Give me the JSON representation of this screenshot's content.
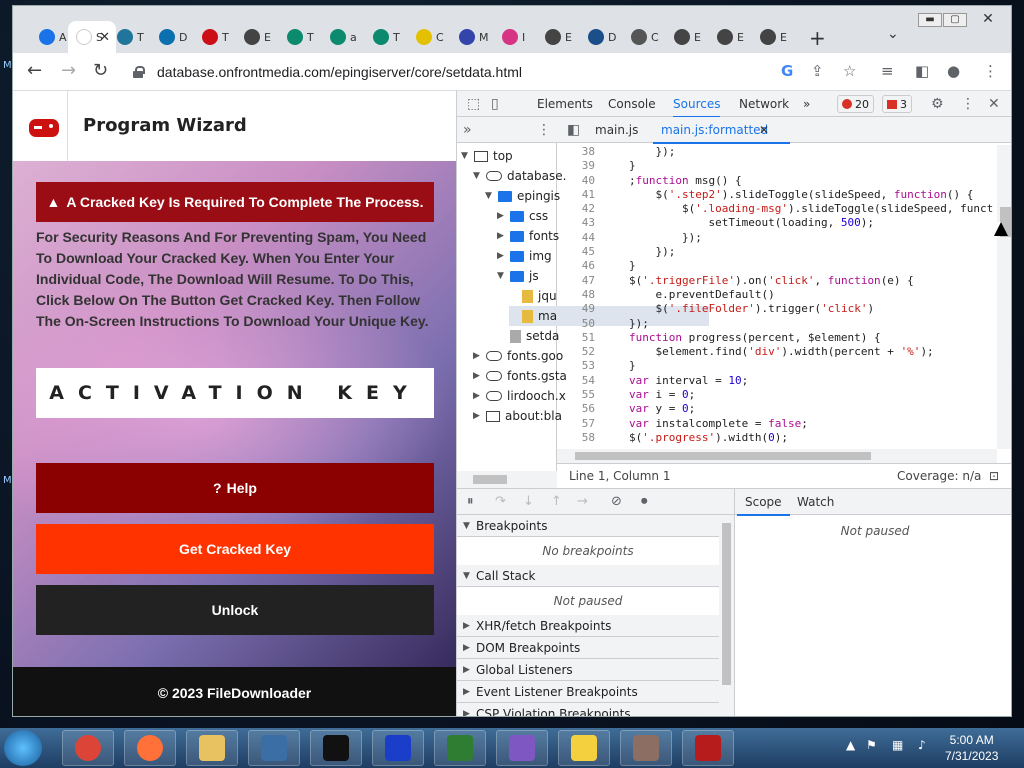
{
  "browser": {
    "tabs": [
      {
        "label": "A",
        "icon": "loading-icon",
        "color": "#1a73e8"
      },
      {
        "label": "S",
        "icon": "page-icon",
        "color": "#ffffff",
        "active": true
      },
      {
        "label": "T",
        "icon": "wordpress-icon",
        "color": "#21759b"
      },
      {
        "label": "D",
        "icon": "cloud-icon",
        "color": "#0b6fb0"
      },
      {
        "label": "T",
        "icon": "opera-icon",
        "color": "#cc0f16"
      },
      {
        "label": "E",
        "icon": "globe-icon",
        "color": "#444444"
      },
      {
        "label": "T",
        "icon": "play-icon",
        "color": "#0b8a6e"
      },
      {
        "label": "a",
        "icon": "play-icon",
        "color": "#0b8a6e"
      },
      {
        "label": "T",
        "icon": "play-icon",
        "color": "#0b8a6e"
      },
      {
        "label": "C",
        "icon": "check-icon",
        "color": "#e3c000"
      },
      {
        "label": "M",
        "icon": "world-icon",
        "color": "#3344aa"
      },
      {
        "label": "I",
        "icon": "ai-icon",
        "color": "#d63384"
      },
      {
        "label": "E",
        "icon": "globe-icon",
        "color": "#444444"
      },
      {
        "label": "D",
        "icon": "s-icon",
        "color": "#1b4f8a"
      },
      {
        "label": "C",
        "icon": "chrome-icon",
        "color": "#555555"
      },
      {
        "label": "E",
        "icon": "globe-icon",
        "color": "#444444"
      },
      {
        "label": "E",
        "icon": "globe-icon",
        "color": "#444444"
      },
      {
        "label": "E",
        "icon": "globe-icon",
        "color": "#444444"
      }
    ],
    "url": "database.onfrontmedia.com/epingiserver/core/setdata.html"
  },
  "page": {
    "title": "Program Wizard",
    "alert": "A Cracked Key Is Required To Complete The Process.",
    "body": "For Security Reasons And For Preventing Spam, You Need To Download Your Cracked Key. When You Enter Your Individual Code, The Download Will Resume. To Do This, Click Below On The Button Get Cracked Key. Then Follow The On-Screen Instructions To Download Your Unique Key.",
    "activation_key": "ACTIVATION KEY",
    "help_button": "Help",
    "get_key_button": "Get Cracked Key",
    "unlock_button": "Unlock",
    "footer": "© 2023 FileDownloader"
  },
  "devtools": {
    "tabs": [
      "Elements",
      "Console",
      "Sources",
      "Network"
    ],
    "active_tab": "Sources",
    "errors": "20",
    "warnings": "3",
    "file_tree": [
      {
        "label": "top",
        "icon": "frame-icon",
        "depth": 0,
        "expanded": true
      },
      {
        "label": "database.",
        "icon": "cloud-icon",
        "depth": 1,
        "expanded": true
      },
      {
        "label": "epingis",
        "icon": "folder-icon",
        "depth": 2,
        "expanded": true
      },
      {
        "label": "css",
        "icon": "folder-icon",
        "depth": 3,
        "expanded": false
      },
      {
        "label": "fonts",
        "icon": "folder-icon",
        "depth": 3,
        "expanded": false
      },
      {
        "label": "img",
        "icon": "folder-icon",
        "depth": 3,
        "expanded": false
      },
      {
        "label": "js",
        "icon": "folder-icon",
        "depth": 3,
        "expanded": true
      },
      {
        "label": "jqu",
        "icon": "file-icon",
        "depth": 4
      },
      {
        "label": "ma",
        "icon": "file-icon",
        "depth": 4,
        "selected": true
      },
      {
        "label": "setda",
        "icon": "file-icon",
        "depth": 3
      },
      {
        "label": "fonts.goo",
        "icon": "cloud-icon",
        "depth": 1,
        "expanded": false
      },
      {
        "label": "fonts.gsta",
        "icon": "cloud-icon",
        "depth": 1,
        "expanded": false
      },
      {
        "label": "lirdooch.x",
        "icon": "cloud-icon",
        "depth": 1,
        "expanded": false
      },
      {
        "label": "about:bla",
        "icon": "frame-icon",
        "depth": 1,
        "expanded": false
      }
    ],
    "editor_tabs": [
      "main.js",
      "main.js:formatted"
    ],
    "code": [
      {
        "n": "38",
        "t": "        });"
      },
      {
        "n": "39",
        "t": "    }"
      },
      {
        "n": "40",
        "t": "    ;function msg() {"
      },
      {
        "n": "41",
        "t": "        $('.step2').slideToggle(slideSpeed, function() {"
      },
      {
        "n": "42",
        "t": "            $('.loading-msg').slideToggle(slideSpeed, funct"
      },
      {
        "n": "43",
        "t": "                setTimeout(loading, 500);"
      },
      {
        "n": "44",
        "t": "            });"
      },
      {
        "n": "45",
        "t": "        });"
      },
      {
        "n": "46",
        "t": "    }"
      },
      {
        "n": "47",
        "t": "    $('.triggerFile').on('click', function(e) {"
      },
      {
        "n": "48",
        "t": "        e.preventDefault()"
      },
      {
        "n": "49",
        "t": "        $('.fileFolder').trigger('click')"
      },
      {
        "n": "50",
        "t": "    });"
      },
      {
        "n": "51",
        "t": "    function progress(percent, $element) {"
      },
      {
        "n": "52",
        "t": "        $element.find('div').width(percent + '%');"
      },
      {
        "n": "53",
        "t": "    }"
      },
      {
        "n": "54",
        "t": "    var interval = 10;"
      },
      {
        "n": "55",
        "t": "    var i = 0;"
      },
      {
        "n": "56",
        "t": "    var y = 0;"
      },
      {
        "n": "57",
        "t": "    var instalcomplete = false;"
      },
      {
        "n": "58",
        "t": "    $('.progress').width(0);"
      }
    ],
    "status_position": "Line 1, Column 1",
    "coverage": "Coverage: n/a",
    "debugger": {
      "sections": [
        {
          "label": "Breakpoints",
          "expanded": true,
          "empty": "No breakpoints"
        },
        {
          "label": "Call Stack",
          "expanded": true,
          "empty": "Not paused"
        },
        {
          "label": "XHR/fetch Breakpoints",
          "expanded": false
        },
        {
          "label": "DOM Breakpoints",
          "expanded": false
        },
        {
          "label": "Global Listeners",
          "expanded": false
        },
        {
          "label": "Event Listener Breakpoints",
          "expanded": false
        },
        {
          "label": "CSP Violation Breakpoints",
          "expanded": false
        }
      ],
      "scope_tabs": [
        "Scope",
        "Watch"
      ],
      "scope_status": "Not paused"
    }
  },
  "taskbar": {
    "apps": [
      {
        "icon": "chrome-icon",
        "color": "#db4437"
      },
      {
        "icon": "firefox-icon",
        "color": "#ff7139"
      },
      {
        "icon": "explorer-icon",
        "color": "#e8c160"
      },
      {
        "icon": "tool-icon",
        "color": "#3a6ea5"
      },
      {
        "icon": "terminal-icon",
        "color": "#111111"
      },
      {
        "icon": "malwarebytes-icon",
        "color": "#1a3ec9"
      },
      {
        "icon": "shield-icon",
        "color": "#2e7d32"
      },
      {
        "icon": "installer-icon",
        "color": "#7e57c2"
      },
      {
        "icon": "puzzle-icon",
        "color": "#f4d03f"
      },
      {
        "icon": "network-icon",
        "color": "#8d6e63"
      },
      {
        "icon": "app-icon",
        "color": "#b71c1c"
      }
    ],
    "time": "5:00 AM",
    "date": "7/31/2023"
  }
}
